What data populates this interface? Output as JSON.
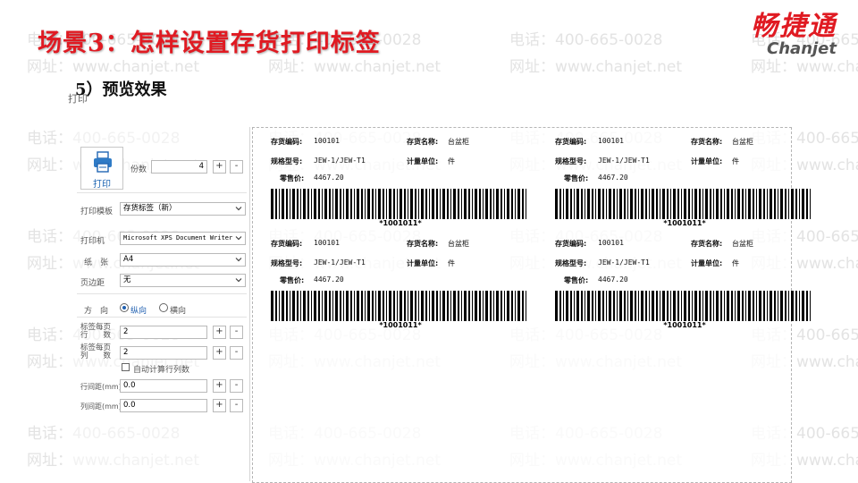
{
  "slide": {
    "title": "场景3：怎样设置存货打印标签",
    "subtitle": "5）预览效果",
    "logo_cn": "畅捷通",
    "logo_en": "Chanjet"
  },
  "watermark": {
    "phone": "电话：400-665-0028",
    "site": "网址：www.chanjet.net"
  },
  "window": {
    "caption": "打印"
  },
  "settings": {
    "print_button_label": "打印",
    "copies_label": "份数",
    "copies_value": "4",
    "template_label": "打印模板",
    "template_value": "存货标签（新）",
    "printer_label": "打印机",
    "printer_value": "Microsoft XPS Document Writer",
    "paper_label": "纸　张",
    "paper_value": "A4",
    "margin_label": "页边距",
    "margin_value": "无",
    "orientation_label": "方　向",
    "orientation_portrait": "纵向",
    "orientation_landscape": "横向",
    "rows_label_1": "标签每页",
    "rows_label_2": "行　　数",
    "rows_value": "2",
    "cols_label_1": "标签每页",
    "cols_label_2": "列　　数",
    "cols_value": "2",
    "auto_calc_label": "自动计算行列数",
    "row_spacing_label": "行间距(mm)",
    "row_spacing_value": "0.0",
    "col_spacing_label": "列间距(mm)",
    "col_spacing_value": "0.0",
    "plus": "+",
    "minus": "-"
  },
  "labels": [
    {
      "code_key": "存货编码:",
      "code": "100101",
      "name_key": "存货名称:",
      "name": "台盆柜",
      "spec_key": "规格型号:",
      "spec": "JEW-1/JEW-T1",
      "unit_key": "计量单位:",
      "unit": "件",
      "price_key": "零售价:",
      "price": "4467.20",
      "barcode_text": "*1001011*"
    },
    {
      "code_key": "存货编码:",
      "code": "100101",
      "name_key": "存货名称:",
      "name": "台盆柜",
      "spec_key": "规格型号:",
      "spec": "JEW-1/JEW-T1",
      "unit_key": "计量单位:",
      "unit": "件",
      "price_key": "零售价:",
      "price": "4467.20",
      "barcode_text": "*1001011*"
    },
    {
      "code_key": "存货编码:",
      "code": "100101",
      "name_key": "存货名称:",
      "name": "台盆柜",
      "spec_key": "规格型号:",
      "spec": "JEW-1/JEW-T1",
      "unit_key": "计量单位:",
      "unit": "件",
      "price_key": "零售价:",
      "price": "4467.20",
      "barcode_text": "*1001011*"
    },
    {
      "code_key": "存货编码:",
      "code": "100101",
      "name_key": "存货名称:",
      "name": "台盆柜",
      "spec_key": "规格型号:",
      "spec": "JEW-1/JEW-T1",
      "unit_key": "计量单位:",
      "unit": "件",
      "price_key": "零售价:",
      "price": "4467.20",
      "barcode_text": "*1001011*"
    }
  ],
  "colors": {
    "title": "#e01a22",
    "accent_blue": "#2167b3",
    "watermark": "#e3e3e3"
  },
  "icons": {
    "printer": "printer-icon",
    "dropdown": "chevron-down-icon"
  }
}
